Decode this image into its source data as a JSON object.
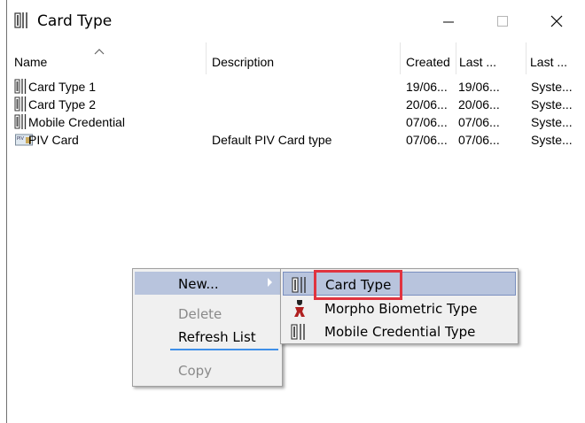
{
  "window": {
    "title": "Card Type",
    "controls": {
      "minimize": "minimize-icon",
      "maximize": "maximize-icon",
      "close": "close-icon"
    }
  },
  "list": {
    "columns": [
      "Name",
      "Description",
      "Created",
      "Last ...",
      "Last ..."
    ],
    "rows": [
      {
        "icon": "card-icon",
        "name": "Card Type 1",
        "description": "",
        "created": "19/06...",
        "last1": "19/06...",
        "last2": "Syste..."
      },
      {
        "icon": "card-icon",
        "name": "Card Type 2",
        "description": "",
        "created": "20/06...",
        "last1": "20/06...",
        "last2": "Syste..."
      },
      {
        "icon": "card-icon",
        "name": "Mobile Credential",
        "description": "",
        "created": "07/06...",
        "last1": "07/06...",
        "last2": "Syste..."
      },
      {
        "icon": "piv-card-icon",
        "name": "PIV Card",
        "description": "Default PIV Card type",
        "created": "07/06...",
        "last1": "07/06...",
        "last2": "Syste..."
      }
    ]
  },
  "context_menu": {
    "new": "New...",
    "delete": "Delete",
    "refresh": "Refresh List",
    "copy": "Copy"
  },
  "submenu": {
    "card_type": "Card Type",
    "morpho": "Morpho Biometric Type",
    "mobile": "Mobile Credential Type"
  },
  "colors": {
    "highlight": "#b8c4dd",
    "callout": "#e0333f",
    "separator": "#3f8fe8"
  }
}
